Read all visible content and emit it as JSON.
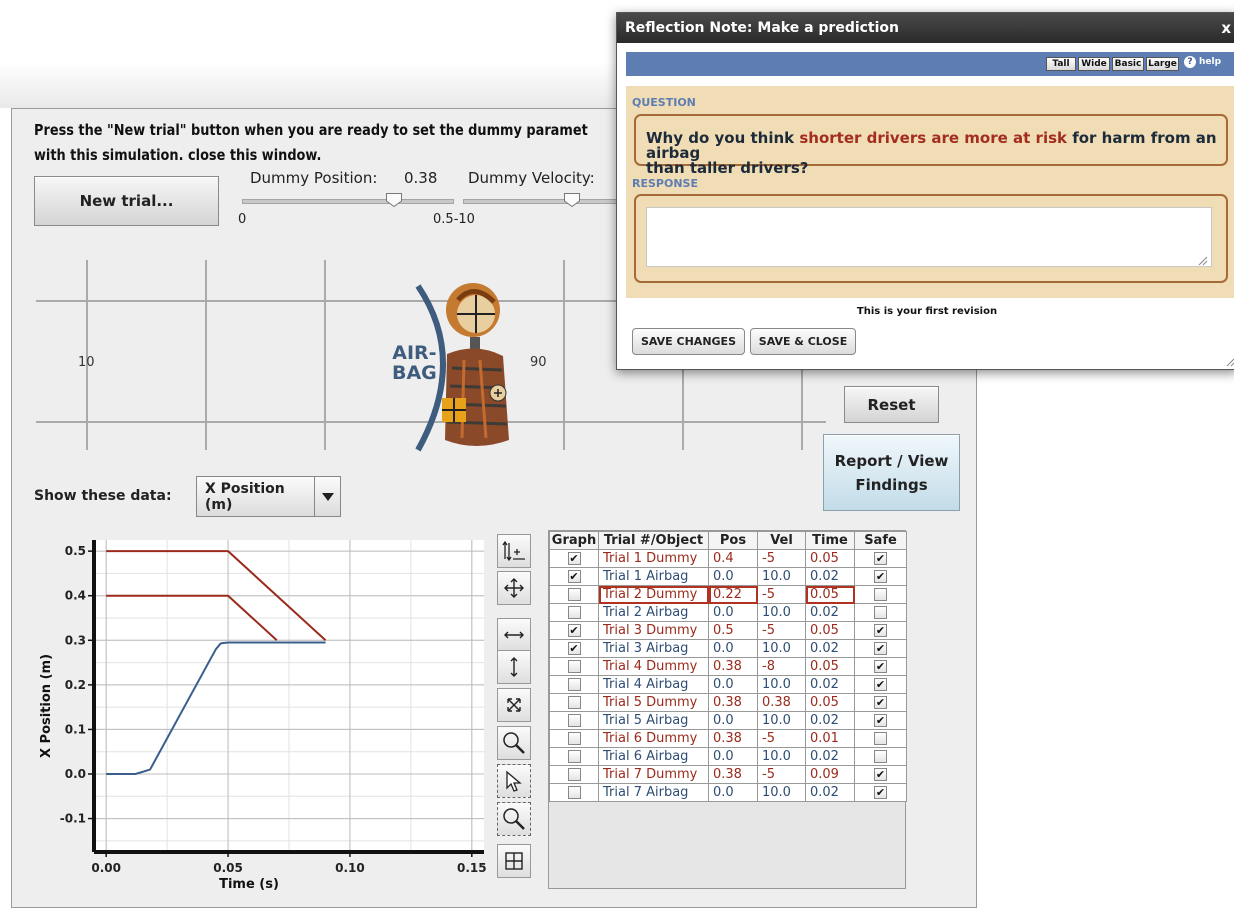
{
  "instructions": {
    "line1": "Press the \"New trial\" button when you are ready to set the dummy paramet",
    "line2": "with this simulation. close this window."
  },
  "controls": {
    "new_trial_label": "New trial...",
    "position_label": "Dummy Position:",
    "position_value": "0.38",
    "position_min": "0",
    "position_max": "0.5",
    "velocity_label": "Dummy Velocity:",
    "velocity_min": "-10",
    "reset_label": "Reset",
    "report_label": "Report / View Findings"
  },
  "scene": {
    "left_number": "10",
    "right_number": "90",
    "airbag_line1": "AIR-",
    "airbag_line2": "BAG"
  },
  "data_select": {
    "label": "Show these data:",
    "value": "X Position (m)"
  },
  "chart_data": {
    "type": "line",
    "xlabel": "Time (s)",
    "ylabel": "X Position (m)",
    "xlim": [
      -0.005,
      0.155
    ],
    "ylim": [
      -0.175,
      0.525
    ],
    "x_ticks": [
      "0.00",
      "0.05",
      "0.10",
      "0.15"
    ],
    "y_ticks": [
      "0.5",
      "0.4",
      "0.3",
      "0.2",
      "0.1",
      "0.0",
      "-0.1"
    ],
    "series": [
      {
        "color": "#9a2a1b",
        "x": [
          0.0,
          0.05,
          0.09
        ],
        "y": [
          0.5,
          0.5,
          0.3
        ]
      },
      {
        "color": "#9a2a1b",
        "x": [
          0.0,
          0.05,
          0.07
        ],
        "y": [
          0.4,
          0.4,
          0.3
        ]
      },
      {
        "color": "#3b5f8c",
        "x": [
          0.0,
          0.012,
          0.018,
          0.02,
          0.045,
          0.047,
          0.05,
          0.09
        ],
        "y": [
          0.0,
          0.0,
          0.01,
          0.03,
          0.28,
          0.293,
          0.295,
          0.295
        ]
      }
    ]
  },
  "tools": [
    "graph-fit-icon",
    "pan-icon",
    "horizontal-scale-icon",
    "vertical-scale-icon",
    "fit-icon",
    "zoom-icon",
    "select-icon",
    "zoom-box-icon",
    "grid-icon"
  ],
  "table": {
    "headers": [
      "Graph",
      "Trial #/Object",
      "Pos",
      "Vel",
      "Time",
      "Safe"
    ],
    "rows": [
      {
        "graph": true,
        "name": "Trial 1 Dummy",
        "pos": "0.4",
        "vel": "-5",
        "time": "0.05",
        "safe": true,
        "color": "red"
      },
      {
        "graph": true,
        "name": "Trial 1 Airbag",
        "pos": "0.0",
        "vel": "10.0",
        "time": "0.02",
        "safe": true,
        "color": "blue"
      },
      {
        "graph": false,
        "name": "Trial 2 Dummy",
        "pos": "0.22",
        "vel": "-5",
        "time": "0.05",
        "safe": false,
        "color": "red",
        "highlight": true
      },
      {
        "graph": false,
        "name": "Trial 2 Airbag",
        "pos": "0.0",
        "vel": "10.0",
        "time": "0.02",
        "safe": false,
        "color": "blue"
      },
      {
        "graph": true,
        "name": "Trial 3 Dummy",
        "pos": "0.5",
        "vel": "-5",
        "time": "0.05",
        "safe": true,
        "color": "red"
      },
      {
        "graph": true,
        "name": "Trial 3 Airbag",
        "pos": "0.0",
        "vel": "10.0",
        "time": "0.02",
        "safe": true,
        "color": "blue"
      },
      {
        "graph": false,
        "name": "Trial 4 Dummy",
        "pos": "0.38",
        "vel": "-8",
        "time": "0.05",
        "safe": true,
        "color": "red"
      },
      {
        "graph": false,
        "name": "Trial 4 Airbag",
        "pos": "0.0",
        "vel": "10.0",
        "time": "0.02",
        "safe": true,
        "color": "blue"
      },
      {
        "graph": false,
        "name": "Trial 5 Dummy",
        "pos": "0.38",
        "vel": "0.38",
        "time": "0.05",
        "safe": true,
        "color": "red"
      },
      {
        "graph": false,
        "name": "Trial 5 Airbag",
        "pos": "0.0",
        "vel": "10.0",
        "time": "0.02",
        "safe": true,
        "color": "blue"
      },
      {
        "graph": false,
        "name": "Trial 6 Dummy",
        "pos": "0.38",
        "vel": "-5",
        "time": "0.01",
        "safe": false,
        "color": "red"
      },
      {
        "graph": false,
        "name": "Trial 6 Airbag",
        "pos": "0.0",
        "vel": "10.0",
        "time": "0.02",
        "safe": false,
        "color": "blue"
      },
      {
        "graph": false,
        "name": "Trial 7 Dummy",
        "pos": "0.38",
        "vel": "-5",
        "time": "0.09",
        "safe": true,
        "color": "red"
      },
      {
        "graph": false,
        "name": "Trial 7 Airbag",
        "pos": "0.0",
        "vel": "10.0",
        "time": "0.02",
        "safe": true,
        "color": "blue"
      }
    ]
  },
  "dialog": {
    "title": "Reflection Note: Make a prediction",
    "close": "x",
    "size_buttons": [
      "Tall",
      "Wide",
      "Basic",
      "Large"
    ],
    "help": "help",
    "question_label": "QUESTION",
    "question_pre": "Why do you think ",
    "question_highlight": "shorter drivers are more at risk",
    "question_post": " for harm from an airbag",
    "question_line2": "than taller drivers?",
    "response_label": "RESPONSE",
    "response_value": "",
    "revision_text": "This is your first revision",
    "save_changes": "SAVE CHANGES",
    "save_close": "SAVE & CLOSE"
  }
}
